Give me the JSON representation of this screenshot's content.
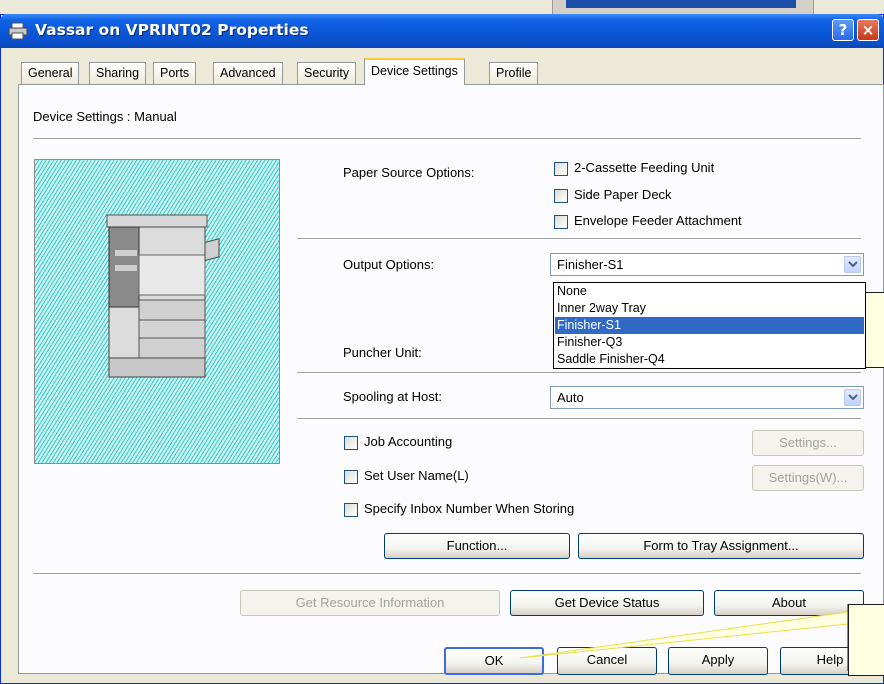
{
  "window": {
    "title": "Vassar on VPRINT02 Properties",
    "help_glyph": "?",
    "close_glyph": "×"
  },
  "tabs": [
    {
      "label": "General"
    },
    {
      "label": "Sharing"
    },
    {
      "label": "Ports"
    },
    {
      "label": "Advanced"
    },
    {
      "label": "Security"
    },
    {
      "label": "Device Settings",
      "active": true
    },
    {
      "label": "Profile"
    }
  ],
  "device_settings": {
    "heading": "Device Settings : Manual",
    "paper_source": {
      "label": "Paper Source Options:",
      "options": [
        {
          "label": "2-Cassette Feeding Unit",
          "checked": false
        },
        {
          "label": "Side Paper Deck",
          "checked": false
        },
        {
          "label": "Envelope Feeder Attachment",
          "checked": false
        }
      ]
    },
    "output": {
      "label": "Output Options:",
      "value": "Finisher-S1",
      "dropdown_open": true,
      "list": [
        "None",
        "Inner 2way Tray",
        "Finisher-S1",
        "Finisher-Q3",
        "Saddle Finisher-Q4"
      ],
      "selected_index": 2
    },
    "puncher": {
      "label": "Puncher Unit:"
    },
    "spooling": {
      "label": "Spooling at Host:",
      "value": "Auto"
    },
    "job_accounting": {
      "label": "Job Accounting",
      "checked": false,
      "settings_label": "Settings..."
    },
    "set_user_name": {
      "label": "Set User Name(L)",
      "checked": false,
      "settings_label": "Settings(W)..."
    },
    "inbox": {
      "label": "Specify Inbox Number When Storing",
      "checked": false
    },
    "function_button": "Function...",
    "form_to_tray_button": "Form to Tray Assignment...",
    "get_resource_button": "Get Resource Information",
    "get_status_button": "Get Device Status",
    "about_button": "About"
  },
  "footer": {
    "ok": "OK",
    "cancel": "Cancel",
    "apply": "Apply",
    "help": "Help"
  },
  "colors": {
    "titlebar": "#0a57d8",
    "selection": "#316ac5",
    "callout_fill": "#ffffe1",
    "pointer_line": "#e8e14a",
    "preview_hatch": "#3ec6c8"
  }
}
